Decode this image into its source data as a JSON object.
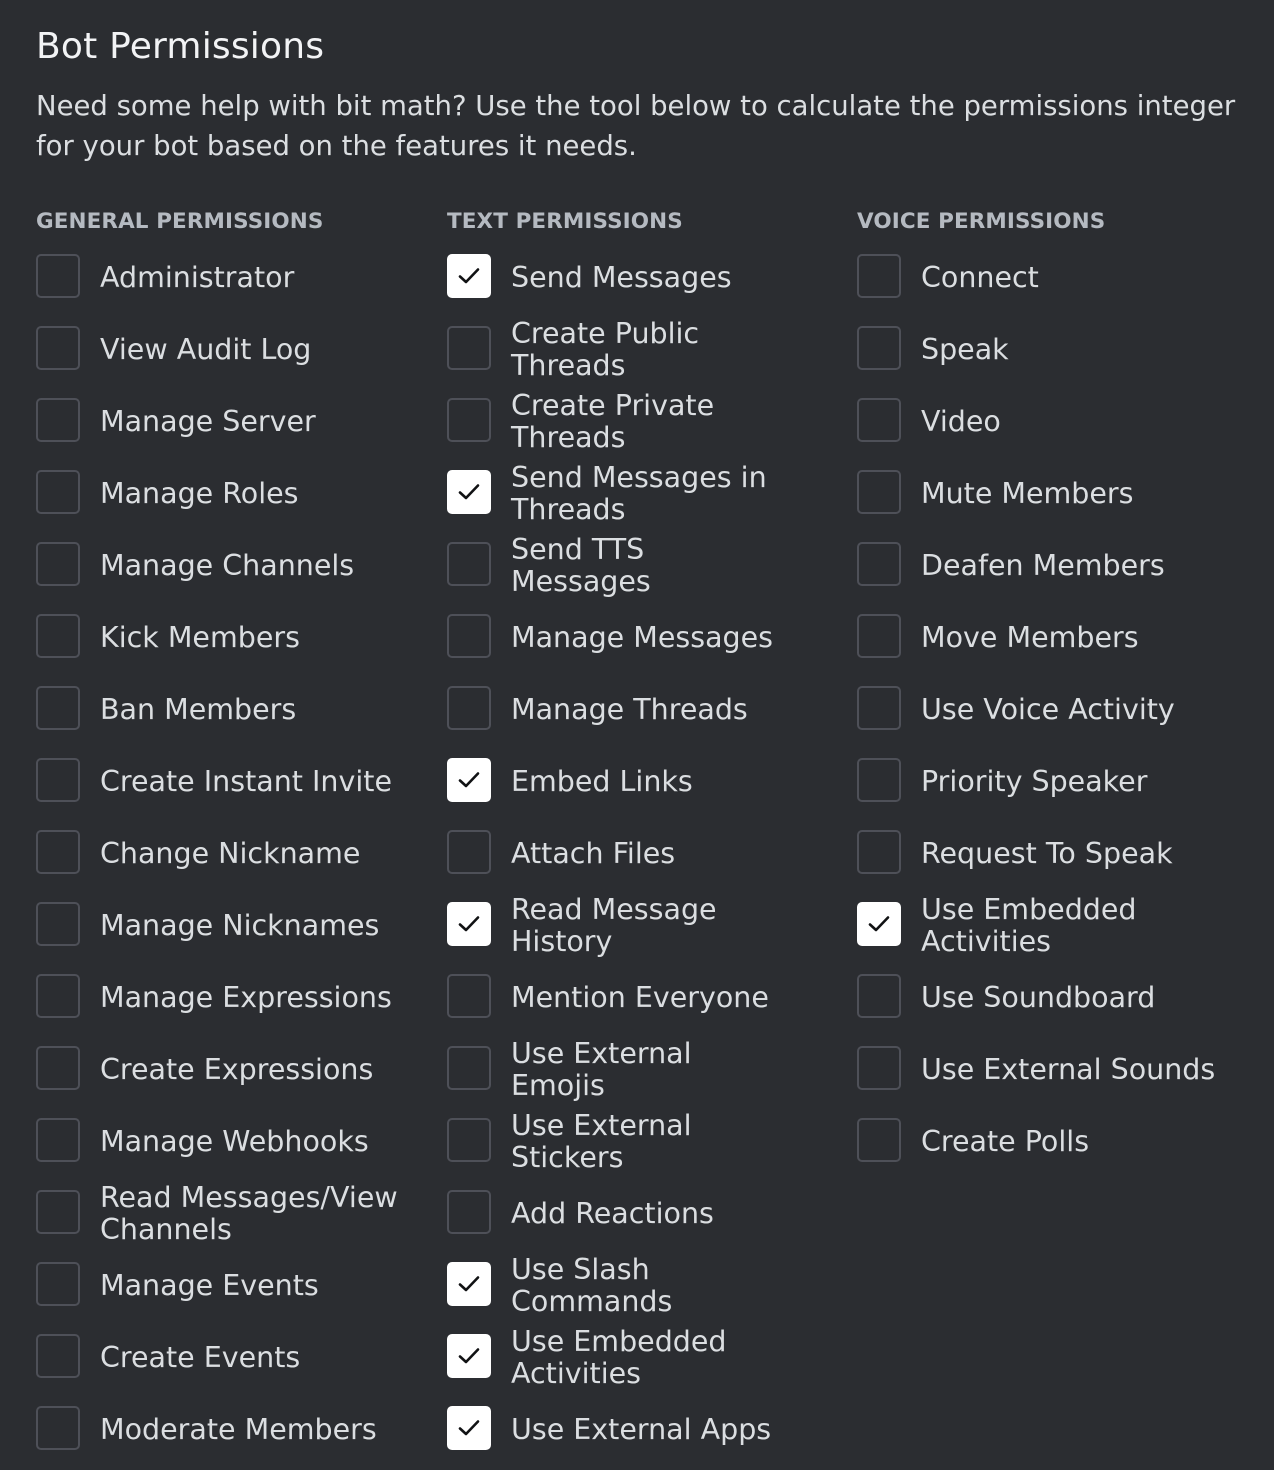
{
  "header": {
    "title": "Bot Permissions",
    "description": "Need some help with bit math? Use the tool below to calculate the permissions integer for your bot based on the features it needs."
  },
  "colors": {
    "background": "#2b2d31",
    "checkbox_border": "#4e5058",
    "checkbox_checked": "#ffffff",
    "text": "#dbdee1"
  },
  "general": {
    "heading": "GENERAL PERMISSIONS",
    "items": [
      {
        "label": "Administrator",
        "checked": false
      },
      {
        "label": "View Audit Log",
        "checked": false
      },
      {
        "label": "Manage Server",
        "checked": false
      },
      {
        "label": "Manage Roles",
        "checked": false
      },
      {
        "label": "Manage Channels",
        "checked": false
      },
      {
        "label": "Kick Members",
        "checked": false
      },
      {
        "label": "Ban Members",
        "checked": false
      },
      {
        "label": "Create Instant Invite",
        "checked": false
      },
      {
        "label": "Change Nickname",
        "checked": false
      },
      {
        "label": "Manage Nicknames",
        "checked": false
      },
      {
        "label": "Manage Expressions",
        "checked": false
      },
      {
        "label": "Create Expressions",
        "checked": false
      },
      {
        "label": "Manage Webhooks",
        "checked": false
      },
      {
        "label": "Read Messages/View Channels",
        "checked": false
      },
      {
        "label": "Manage Events",
        "checked": false
      },
      {
        "label": "Create Events",
        "checked": false
      },
      {
        "label": "Moderate Members",
        "checked": false
      }
    ]
  },
  "text": {
    "heading": "TEXT PERMISSIONS",
    "items": [
      {
        "label": "Send Messages",
        "checked": true
      },
      {
        "label": "Create Public Threads",
        "checked": false
      },
      {
        "label": "Create Private Threads",
        "checked": false
      },
      {
        "label": "Send Messages in Threads",
        "checked": true
      },
      {
        "label": "Send TTS Messages",
        "checked": false
      },
      {
        "label": "Manage Messages",
        "checked": false
      },
      {
        "label": "Manage Threads",
        "checked": false
      },
      {
        "label": "Embed Links",
        "checked": true
      },
      {
        "label": "Attach Files",
        "checked": false
      },
      {
        "label": "Read Message History",
        "checked": true
      },
      {
        "label": "Mention Everyone",
        "checked": false
      },
      {
        "label": "Use External Emojis",
        "checked": false
      },
      {
        "label": "Use External Stickers",
        "checked": false
      },
      {
        "label": "Add Reactions",
        "checked": false
      },
      {
        "label": "Use Slash Commands",
        "checked": true
      },
      {
        "label": "Use Embedded Activities",
        "checked": true
      },
      {
        "label": "Use External Apps",
        "checked": true
      }
    ]
  },
  "voice": {
    "heading": "VOICE PERMISSIONS",
    "items": [
      {
        "label": "Connect",
        "checked": false
      },
      {
        "label": "Speak",
        "checked": false
      },
      {
        "label": "Video",
        "checked": false
      },
      {
        "label": "Mute Members",
        "checked": false
      },
      {
        "label": "Deafen Members",
        "checked": false
      },
      {
        "label": "Move Members",
        "checked": false
      },
      {
        "label": "Use Voice Activity",
        "checked": false
      },
      {
        "label": "Priority Speaker",
        "checked": false
      },
      {
        "label": "Request To Speak",
        "checked": false
      },
      {
        "label": "Use Embedded Activities",
        "checked": true
      },
      {
        "label": "Use Soundboard",
        "checked": false
      },
      {
        "label": "Use External Sounds",
        "checked": false
      },
      {
        "label": "Create Polls",
        "checked": false
      }
    ]
  }
}
